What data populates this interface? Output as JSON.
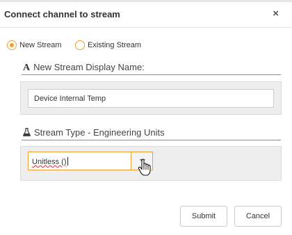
{
  "dialog": {
    "title": "Connect channel to stream",
    "close_symbol": "×"
  },
  "stream_choice": {
    "options": [
      {
        "label": "New Stream",
        "selected": true
      },
      {
        "label": "Existing Stream",
        "selected": false
      }
    ]
  },
  "display_name": {
    "icon": "text-font-icon",
    "icon_glyph": "A",
    "label": "New Stream Display Name:",
    "value": "Device Internal Temp"
  },
  "stream_type": {
    "icon": "flask-icon",
    "label": "Stream Type - Engineering Units",
    "value": "Unitless ()",
    "dropdown_icon": "chevron-down-icon"
  },
  "buttons": {
    "submit": "Submit",
    "cancel": "Cancel"
  },
  "colors": {
    "accent": "#f0a030",
    "panel_bg": "#eeeeee",
    "spellcheck": "#d03030"
  }
}
